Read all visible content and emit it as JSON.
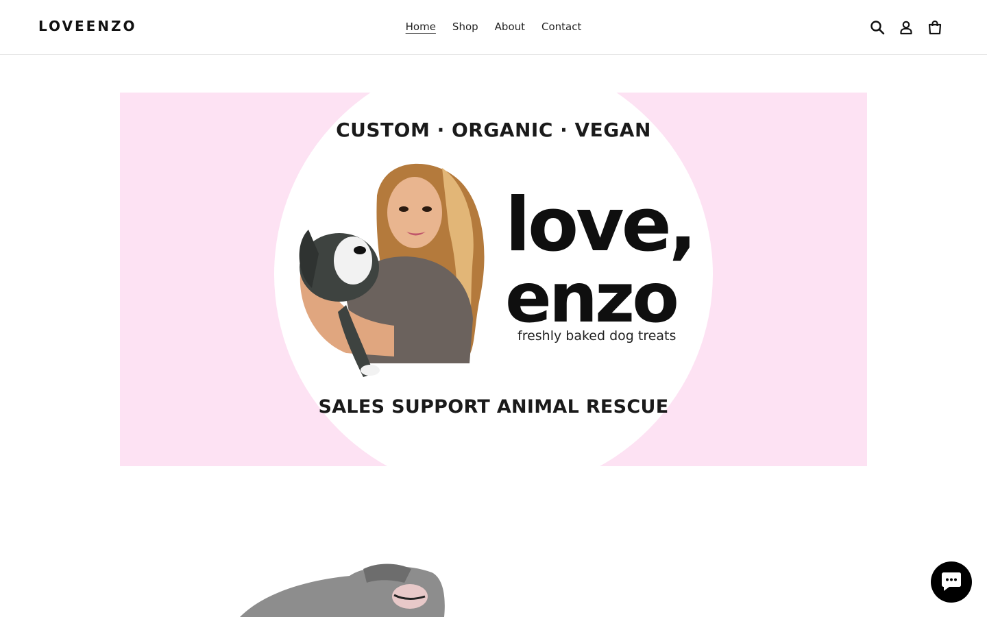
{
  "header": {
    "logo": "LOVEENZO",
    "nav": [
      {
        "label": "Home",
        "active": true
      },
      {
        "label": "Shop",
        "active": false
      },
      {
        "label": "About",
        "active": false
      },
      {
        "label": "Contact",
        "active": false
      }
    ],
    "icons": [
      "search-icon",
      "account-icon",
      "cart-icon"
    ]
  },
  "hero": {
    "tagline_top": "CUSTOM · ORGANIC · VEGAN",
    "brand_line1": "love,",
    "brand_line2": "enzo",
    "brand_subtitle": "freshly baked dog treats",
    "tagline_bottom": "SALES SUPPORT ANIMAL RESCUE",
    "background_color": "#fde2f3"
  },
  "chat": {
    "icon": "chat-icon"
  }
}
